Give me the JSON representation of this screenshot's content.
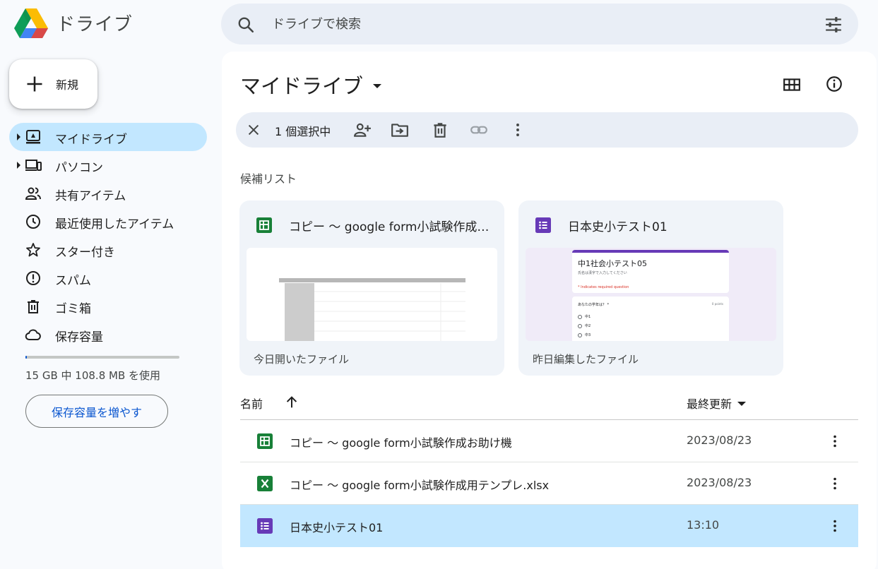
{
  "app": {
    "title": "ドライブ"
  },
  "search": {
    "placeholder": "ドライブで検索"
  },
  "sidebar": {
    "new_label": "新規",
    "items": [
      {
        "label": "マイドライブ",
        "icon": "my-drive-icon",
        "active": true,
        "caret": true
      },
      {
        "label": "パソコン",
        "icon": "computers-icon",
        "active": false,
        "caret": true
      },
      {
        "label": "共有アイテム",
        "icon": "shared-icon",
        "active": false,
        "caret": false
      },
      {
        "label": "最近使用したアイテム",
        "icon": "clock-icon",
        "active": false,
        "caret": false
      },
      {
        "label": "スター付き",
        "icon": "star-icon",
        "active": false,
        "caret": false
      },
      {
        "label": "スパム",
        "icon": "spam-icon",
        "active": false,
        "caret": false
      },
      {
        "label": "ゴミ箱",
        "icon": "trash-icon",
        "active": false,
        "caret": false
      },
      {
        "label": "保存容量",
        "icon": "cloud-icon",
        "active": false,
        "caret": false
      }
    ],
    "storage": {
      "used_fraction": 0.007,
      "text": "15 GB 中 108.8 MB を使用",
      "button": "保存容量を増やす"
    }
  },
  "main": {
    "title": "マイドライブ",
    "selection": {
      "count_label": "1 個選択中"
    },
    "suggested": {
      "label": "候補リスト",
      "cards": [
        {
          "title": "コピー ～ google form小試験作成お助け機",
          "subtitle": "今日開いたファイル",
          "type": "sheets"
        },
        {
          "title": "日本史小テスト01",
          "subtitle": "昨日編集したファイル",
          "type": "forms",
          "preview": {
            "heading": "中1社会小テスト05",
            "note": "氏名は漢字で入力してください",
            "required": "* Indicates required question",
            "question": "あなたの学年は？ *",
            "points": "0 points",
            "options": [
              "中1",
              "中2",
              "中3"
            ]
          }
        }
      ]
    },
    "list": {
      "col_name": "名前",
      "col_modified": "最終更新",
      "rows": [
        {
          "name": "コピー ～ google form小試験作成お助け機",
          "date": "2023/08/23",
          "type": "sheets",
          "selected": false
        },
        {
          "name": "コピー ～ google form小試験作成用テンプレ.xlsx",
          "date": "2023/08/23",
          "type": "excel",
          "selected": false
        },
        {
          "name": "日本史小テスト01",
          "date": "13:10",
          "type": "forms",
          "selected": true
        }
      ]
    }
  },
  "colors": {
    "accent": "#0b57d0",
    "selected": "#c2e7ff",
    "sheets": "#188038",
    "forms": "#673ab7"
  }
}
